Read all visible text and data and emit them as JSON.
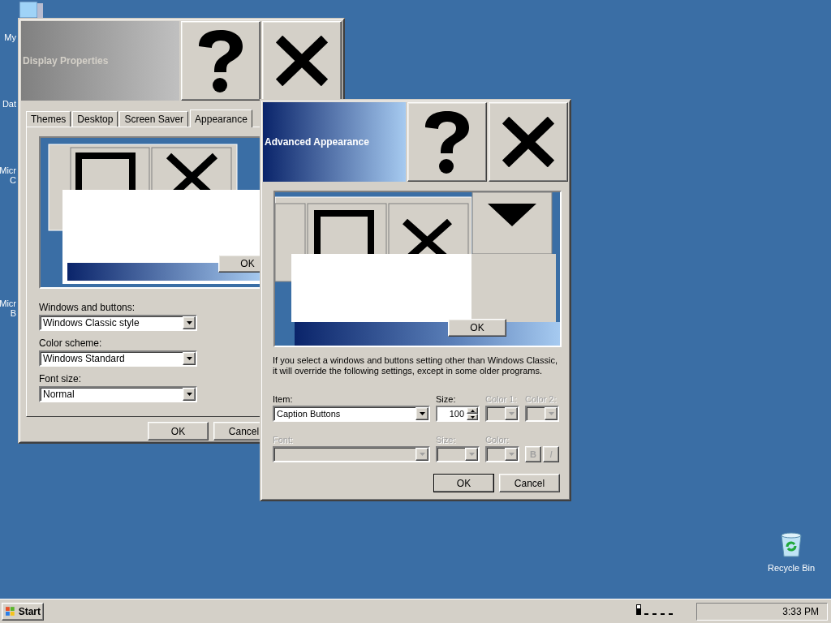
{
  "desktop_labels": [
    {
      "lines": [
        "My"
      ]
    },
    {
      "lines": [
        "Dat"
      ]
    },
    {
      "lines": [
        "Micr",
        "C"
      ]
    },
    {
      "lines": [
        "Micr",
        "B"
      ]
    }
  ],
  "recycle_bin": {
    "label": "Recycle Bin"
  },
  "windows": [
    {
      "kind": "tabbed",
      "title": "Display Properties",
      "active": false,
      "tabs": [
        {
          "label": "Themes",
          "selected": false
        },
        {
          "label": "Desktop",
          "selected": false
        },
        {
          "label": "Screen Saver",
          "selected": false
        },
        {
          "label": "Appearance",
          "selected": true
        }
      ],
      "preview": {
        "button": "OK"
      },
      "fields": [
        {
          "label": "Windows and buttons:",
          "value": "Windows Classic style"
        },
        {
          "label": "Color scheme:",
          "value": "Windows Standard"
        },
        {
          "label": "Font size:",
          "value": "Normal"
        }
      ],
      "buttons": [
        "OK",
        "Cancel"
      ]
    },
    {
      "kind": "advanced",
      "title": "Advanced Appearance",
      "active": true,
      "preview": {
        "button": "OK"
      },
      "note": "If you select a windows and buttons setting other than Windows Classic, it will override the following settings, except in some older programs.",
      "controls": [
        {
          "kind": "combo",
          "label": "Item:",
          "value": "Caption Buttons",
          "disabled": false
        },
        {
          "kind": "spin",
          "label": "Size:",
          "value": "100",
          "disabled": false
        },
        {
          "kind": "color",
          "label": "Color 1:",
          "disabled": true
        },
        {
          "kind": "color",
          "label": "Color 2:",
          "disabled": true
        },
        {
          "kind": "combo",
          "label": "Font:",
          "disabled": true
        },
        {
          "kind": "combo",
          "label": "Size:",
          "disabled": true
        },
        {
          "kind": "color",
          "label": "Color:",
          "disabled": true
        },
        {
          "kind": "style",
          "bold": "B",
          "italic": "I",
          "disabled": true
        }
      ],
      "buttons": [
        "OK",
        "Cancel"
      ]
    }
  ],
  "taskbar": {
    "start": "Start",
    "clock": "3:33 PM"
  }
}
